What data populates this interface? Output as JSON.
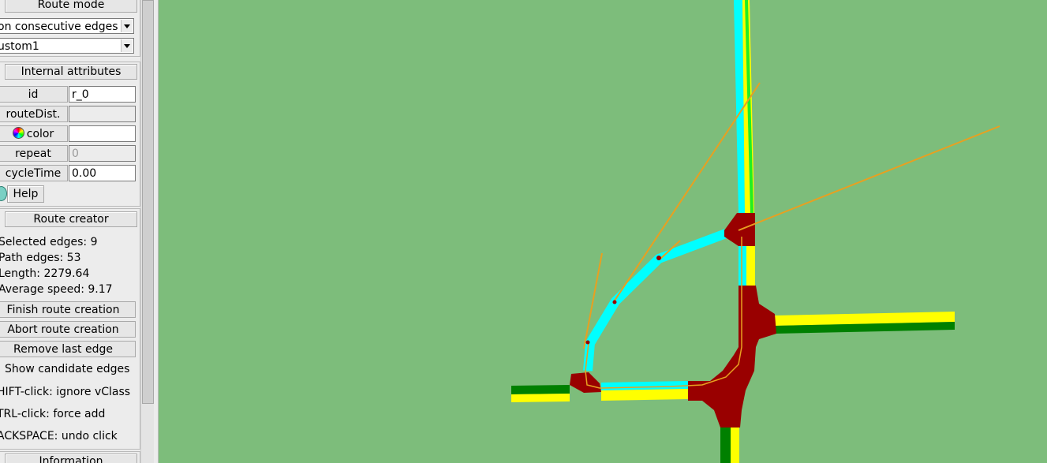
{
  "route_mode": {
    "header": "Route mode",
    "mode_select": "on consecutive edges",
    "vtype_select": "ustom1"
  },
  "internal_attributes": {
    "header": "Internal attributes",
    "fields": [
      {
        "label": "id",
        "value": "r_0",
        "disabled": false
      },
      {
        "label": "routeDist.",
        "value": "",
        "disabled": true
      },
      {
        "label": "color",
        "value": "",
        "disabled": false
      },
      {
        "label": "repeat",
        "value": "0",
        "disabled": true
      },
      {
        "label": "cycleTime",
        "value": "0.00",
        "disabled": false
      }
    ],
    "help_label": "Help"
  },
  "route_creator": {
    "header": "Route creator",
    "selected_edges": "Selected edges: 9",
    "path_edges": "Path edges: 53",
    "length": "Length: 2279.64",
    "average_speed": "Average speed: 9.17",
    "finish_label": "Finish route creation",
    "abort_label": "Abort route creation",
    "remove_label": "Remove last edge",
    "show_candidates_label": "Show candidate edges",
    "hint_shift": "HIFT-click: ignore vClass",
    "hint_ctrl": "TRL-click: force add",
    "hint_backspace": "ACKSPACE: undo click"
  },
  "information": {
    "header": "Information"
  },
  "colors": {
    "background": "#7dbd7b",
    "junction": "#990000",
    "lane_yellow": "#ffff00",
    "lane_green": "#008000",
    "selected_lane": "#00ffff",
    "route_line": "#e8a020"
  }
}
